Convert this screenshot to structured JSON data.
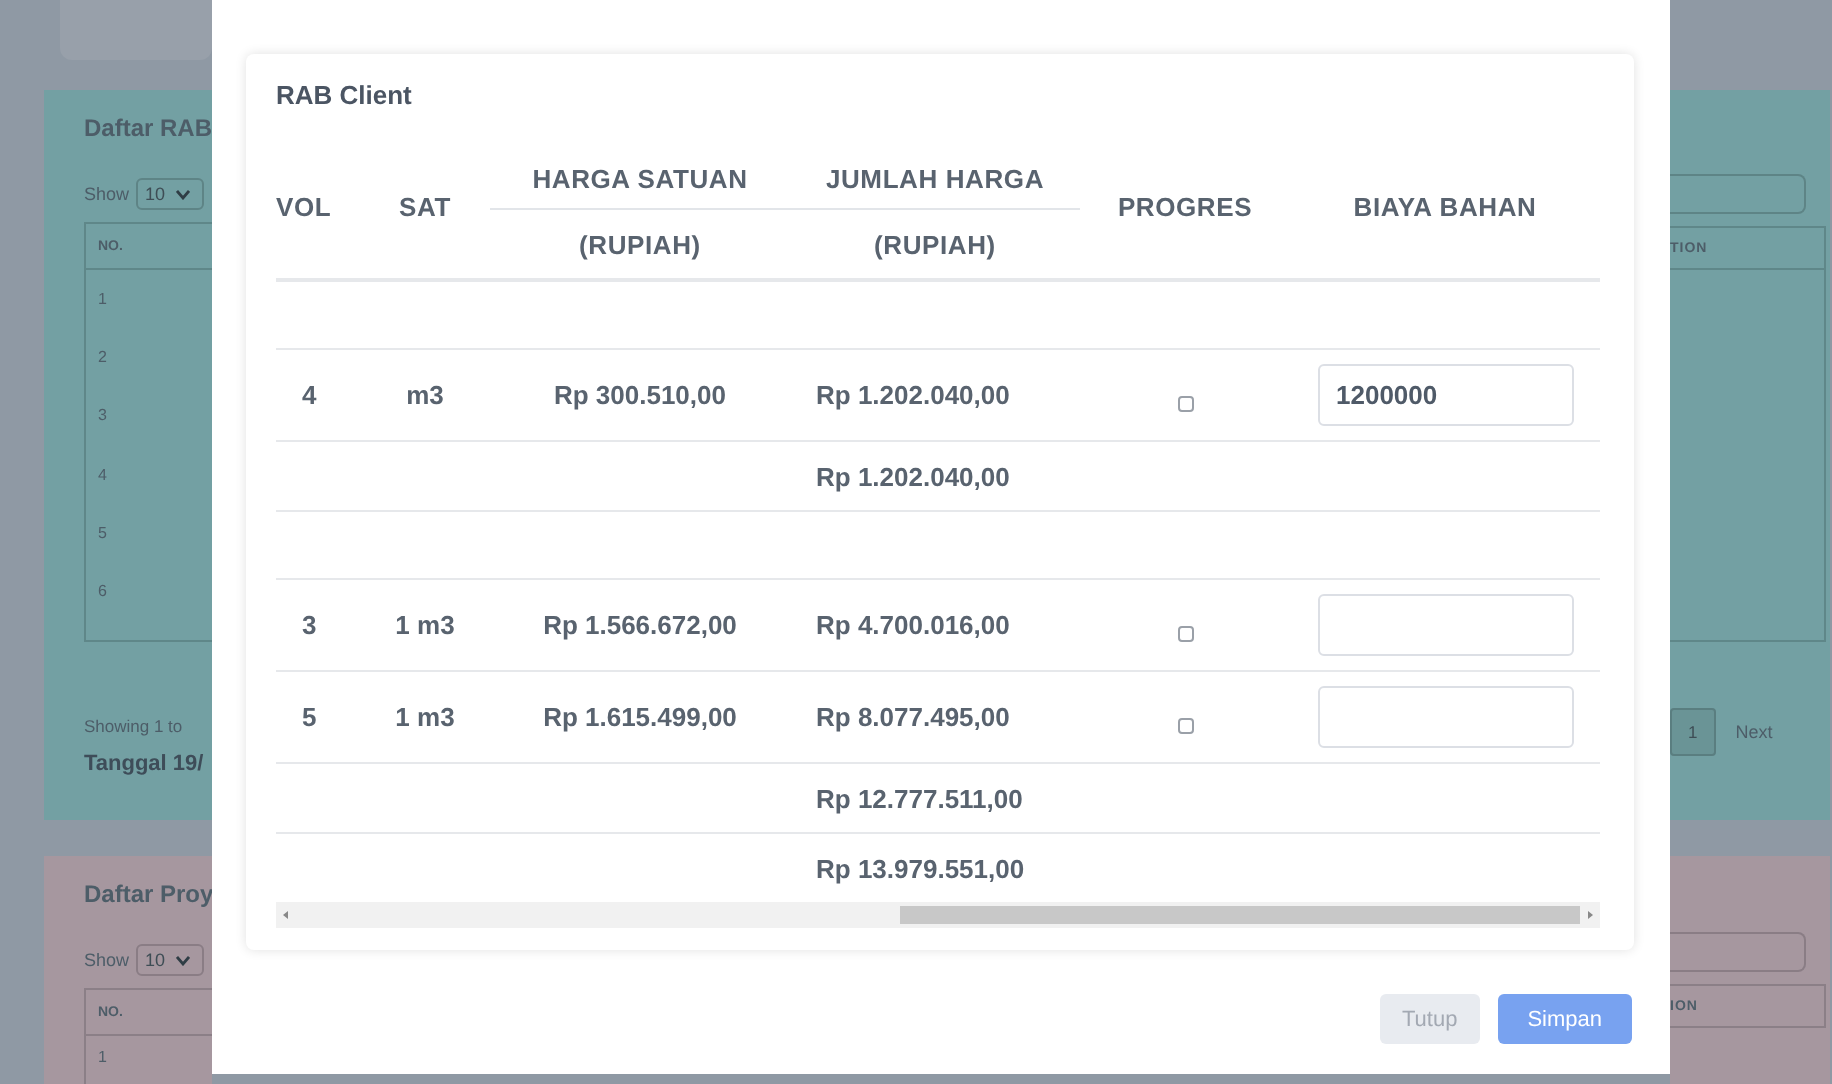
{
  "background": {
    "rab_card": {
      "title": "Daftar RAB",
      "show_label": "Show",
      "page_size": "10",
      "column_1": "NO.",
      "rows": [
        "1",
        "2",
        "3",
        "4",
        "5",
        "6"
      ],
      "info": "Showing 1 to",
      "date": "Tanggal 19/",
      "right_column": "TION",
      "page": "1",
      "next": "Next"
    },
    "project_card": {
      "title": "Daftar Proy",
      "show_label": "Show",
      "page_size": "10",
      "column_1": "NO.",
      "rows": [
        "1"
      ],
      "right_column": "ION"
    }
  },
  "modal": {
    "title": "RAB Client",
    "columns": [
      {
        "label": "VOL"
      },
      {
        "label": "SAT"
      },
      {
        "label": "HARGA SATUAN",
        "sub": "(RUPIAH)"
      },
      {
        "label": "JUMLAH HARGA",
        "sub": "(RUPIAH)"
      },
      {
        "label": "PROGRES"
      },
      {
        "label": "BIAYA BAHAN"
      }
    ],
    "rows": [
      {
        "kind": "spacer"
      },
      {
        "kind": "item",
        "vol": "4",
        "sat": "m3",
        "harga_satuan": "Rp 300.510,00",
        "jumlah_harga": "Rp 1.202.040,00",
        "checked": false,
        "biaya_bahan": "1200000"
      },
      {
        "kind": "subtotal",
        "jumlah_harga": "Rp 1.202.040,00"
      },
      {
        "kind": "spacer"
      },
      {
        "kind": "item",
        "vol": "3",
        "sat": "1 m3",
        "harga_satuan": "Rp 1.566.672,00",
        "jumlah_harga": "Rp 4.700.016,00",
        "checked": false
      },
      {
        "kind": "item",
        "vol": "5",
        "sat": "1 m3",
        "harga_satuan": "Rp 1.615.499,00",
        "jumlah_harga": "Rp 8.077.495,00",
        "checked": false
      },
      {
        "kind": "subtotal",
        "jumlah_harga": "Rp 12.777.511,00"
      },
      {
        "kind": "subtotal",
        "jumlah_harga": "Rp 13.979.551,00"
      }
    ],
    "buttons": [
      {
        "label": "Tutup",
        "kind": "secondary"
      },
      {
        "label": "Simpan",
        "kind": "primary"
      }
    ]
  }
}
